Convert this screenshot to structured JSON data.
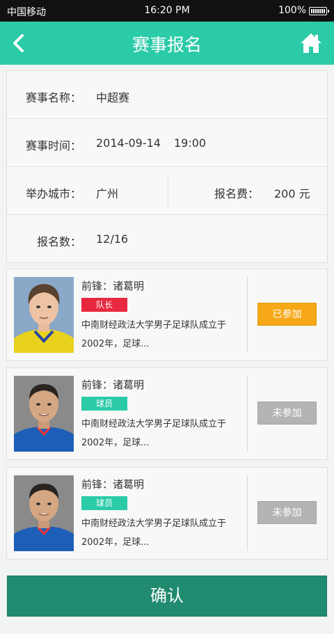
{
  "status_bar": {
    "carrier": "中国移动",
    "time": "16:20 PM",
    "battery": "100%"
  },
  "header": {
    "title": "赛事报名",
    "back_icon": "chevron-left-icon",
    "home_icon": "home-icon"
  },
  "event": {
    "name_label": "赛事名称：",
    "name_value": "中超赛",
    "time_label": "赛事时间：",
    "date_value": "2014-09-14",
    "time_value": "19:00",
    "city_label": "举办城市：",
    "city_value": "广州",
    "fee_label": "报名费：",
    "fee_value": "200 元",
    "count_label": "报名数：",
    "count_value": "12/16"
  },
  "players": [
    {
      "name": "前锋：诸葛明",
      "tag": "队长",
      "desc": "中南财经政法大学男子足球队成立于2002年，足球...",
      "status": "已参加"
    },
    {
      "name": "前锋：诸葛明",
      "tag": "球员",
      "desc": "中南财经政法大学男子足球队成立于2002年，足球...",
      "status": "未参加"
    },
    {
      "name": "前锋：诸葛明",
      "tag": "球员",
      "desc": "中南财经政法大学男子足球队成立于2002年，足球...",
      "status": "未参加"
    }
  ],
  "confirm_label": "确认",
  "colors": {
    "accent": "#2bcba8",
    "captain": "#e8283e",
    "joined": "#f7a817",
    "not_joined": "#b4b4b4",
    "confirm": "#208b6e"
  }
}
